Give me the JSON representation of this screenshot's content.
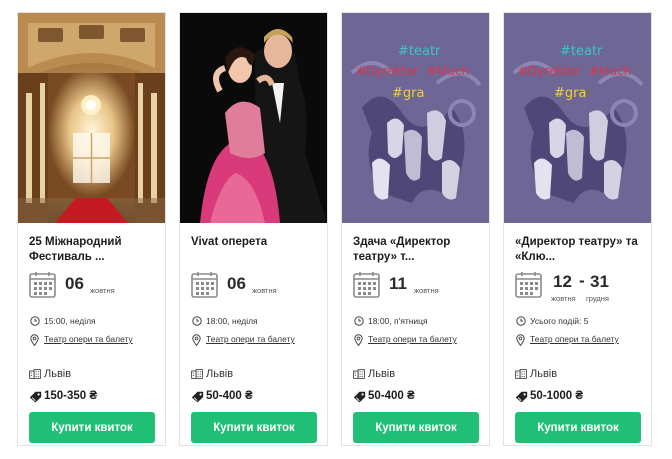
{
  "colors": {
    "accent": "#1fbf76",
    "poster_bg": "#6e6694",
    "poster_red": "#e0334d",
    "poster_teal": "#3fc4c6",
    "poster_yellow": "#f2d03a"
  },
  "events": [
    {
      "title": "25 Міжнародний Фестиваль ...",
      "image": "palace-hall-interior",
      "date": {
        "day": "06",
        "month": "жовтня"
      },
      "time": "15:00, неділя",
      "venue": "Театр опери та балету",
      "city": "Львів",
      "price": "150-350 ₴",
      "buy_label": "Купити квиток"
    },
    {
      "title": "Vivat оперета",
      "image": "operetta-couple-photo",
      "date": {
        "day": "06",
        "month": "жовтня"
      },
      "time": "18:00, неділя",
      "venue": "Театр опери та балету",
      "city": "Львів",
      "price": "50-400 ₴",
      "buy_label": "Купити квиток"
    },
    {
      "title": "Здача «Директор театру» т...",
      "image": "teatr-poster",
      "poster_lines": [
        "#teatr",
        "#Dyrektor",
        "#kluch",
        "#gra"
      ],
      "date": {
        "day": "11",
        "month": "жовтня"
      },
      "time": "18:00, п'ятниця",
      "venue": "Театр опери та балету",
      "city": "Львів",
      "price": "50-400 ₴",
      "buy_label": "Купити квиток"
    },
    {
      "title": "«Директор театру» та «Клю...",
      "image": "teatr-poster",
      "poster_lines": [
        "#teatr",
        "#Dyrektor",
        "#kluch",
        "#gra"
      ],
      "date_range": {
        "start_day": "12",
        "dash": "-",
        "end_day": "31",
        "start_month": "жовтня",
        "end_month": "грудня"
      },
      "time": "Усього подій: 5",
      "venue": "Театр опери та балету",
      "city": "Львів",
      "price": "50-1000 ₴",
      "buy_label": "Купити квиток"
    }
  ]
}
